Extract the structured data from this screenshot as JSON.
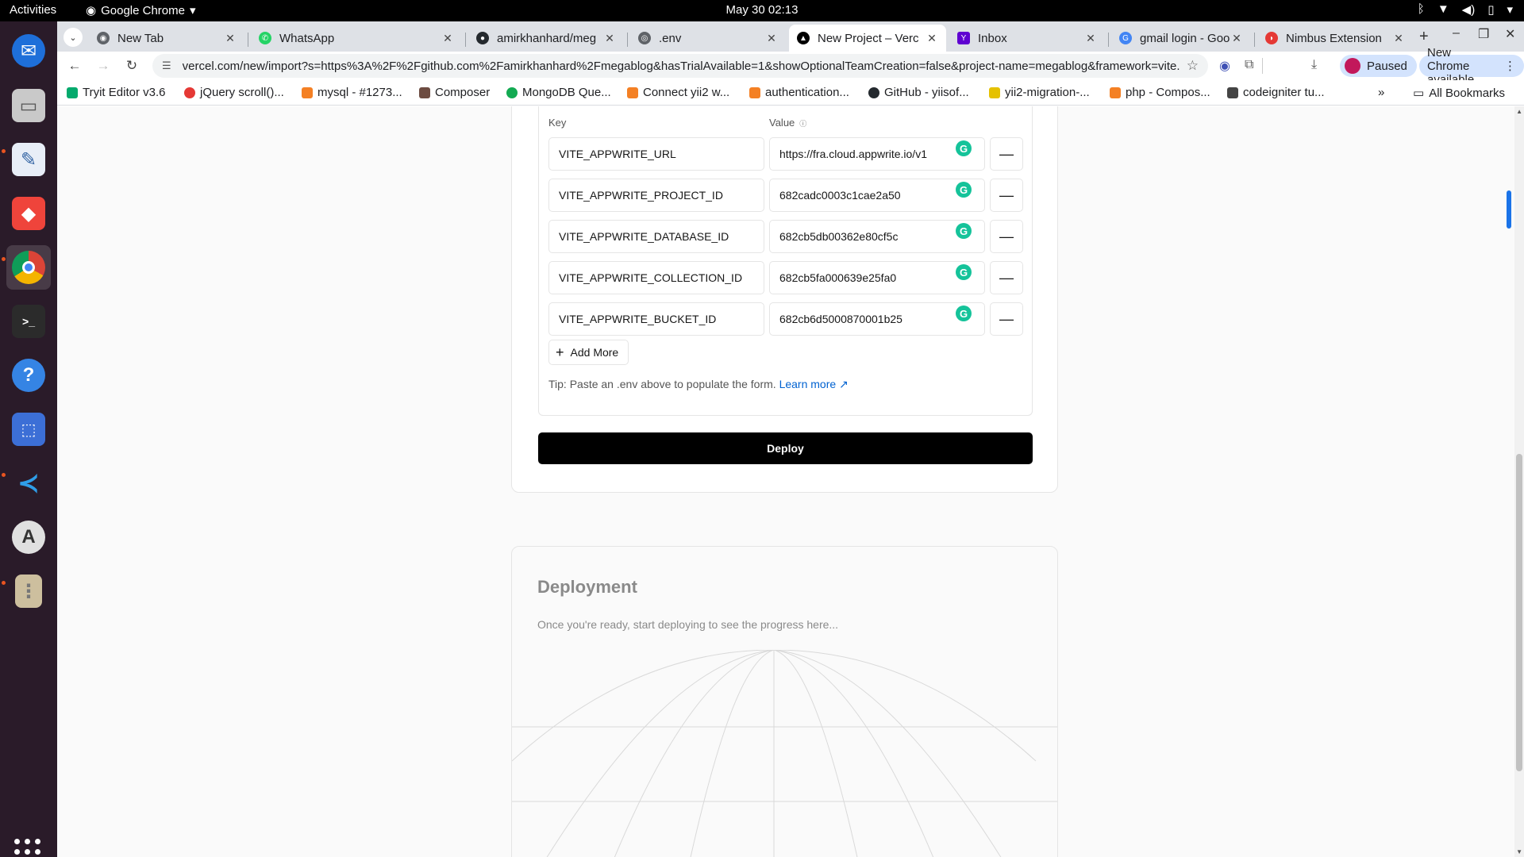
{
  "system": {
    "activities": "Activities",
    "app_name": "Google Chrome",
    "clock": "May 30  02:13"
  },
  "tabs": [
    {
      "title": "New Tab",
      "active": false
    },
    {
      "title": "WhatsApp",
      "active": false
    },
    {
      "title": "amirkhanhard/meg",
      "active": false
    },
    {
      "title": ".env",
      "active": false
    },
    {
      "title": "New Project – Verc",
      "active": true
    },
    {
      "title": "Inbox",
      "active": false
    },
    {
      "title": "gmail login - Googl",
      "active": false
    },
    {
      "title": "Nimbus Extension",
      "active": false
    }
  ],
  "toolbar": {
    "url": "vercel.com/new/import?s=https%3A%2F%2Fgithub.com%2Famirkhanhard%2Fmegablog&hasTrialAvailable=1&showOptionalTeamCreation=false&project-name=megablog&framework=vite...",
    "profile_label": "Paused",
    "update_label": "New Chrome available"
  },
  "bookmarks": [
    {
      "label": "Tryit Editor v3.6",
      "color": "#04aa6d"
    },
    {
      "label": "jQuery scroll()...",
      "color": "#e53935"
    },
    {
      "label": "mysql - #1273...",
      "color": "#f48024"
    },
    {
      "label": "Composer",
      "color": "#6d4c41"
    },
    {
      "label": "MongoDB Que...",
      "color": "#13aa52"
    },
    {
      "label": "Connect yii2 w...",
      "color": "#f48024"
    },
    {
      "label": "authentication...",
      "color": "#f48024"
    },
    {
      "label": "GitHub - yiisof...",
      "color": "#24292e"
    },
    {
      "label": "yii2-migration-...",
      "color": "#e5c100"
    },
    {
      "label": "php - Compos...",
      "color": "#f48024"
    },
    {
      "label": "codeigniter tu...",
      "color": "#444444"
    }
  ],
  "all_bookmarks": "All Bookmarks",
  "env": {
    "key_header": "Key",
    "value_header": "Value",
    "rows": [
      {
        "key": "VITE_APPWRITE_URL",
        "value": "https://fra.cloud.appwrite.io/v1"
      },
      {
        "key": "VITE_APPWRITE_PROJECT_ID",
        "value": "682cadc0003c1cae2a50"
      },
      {
        "key": "VITE_APPWRITE_DATABASE_ID",
        "value": "682cb5db00362e80cf5c"
      },
      {
        "key": "VITE_APPWRITE_COLLECTION_ID",
        "value": "682cb5fa000639e25fa0"
      },
      {
        "key": "VITE_APPWRITE_BUCKET_ID",
        "value": "682cb6d5000870001b25"
      }
    ],
    "add_more": "Add More",
    "tip": "Tip: Paste an .env above to populate the form.",
    "learn_more": "Learn more"
  },
  "deploy_button": "Deploy",
  "deployment": {
    "title": "Deployment",
    "subtitle": "Once you're ready, start deploying to see the progress here..."
  },
  "colors": {
    "accent": "#000000",
    "link": "#0062d1",
    "grammarly": "#15c39a",
    "dock_bg": "#2a1b29"
  }
}
